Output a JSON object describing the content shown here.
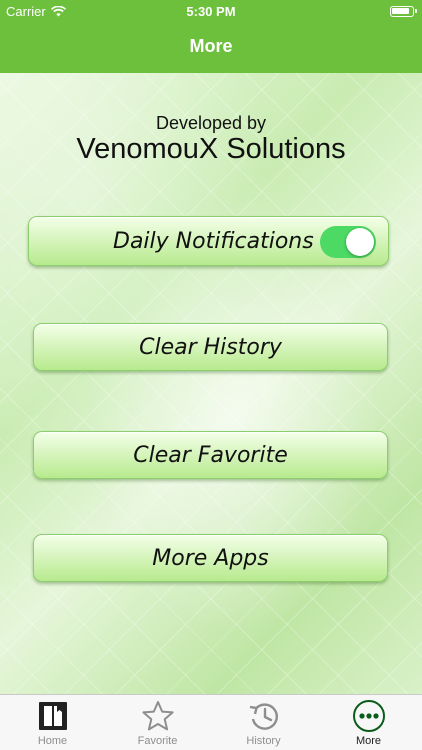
{
  "status": {
    "carrier": "Carrier",
    "time": "5:30 PM"
  },
  "nav": {
    "title": "More"
  },
  "about": {
    "label": "Developed by",
    "name": "VenomouX Solutions"
  },
  "menu": {
    "daily_notifications": {
      "label": "Daily Notifications",
      "enabled": true
    },
    "clear_history": "Clear History",
    "clear_favorite": "Clear Favorite",
    "more_apps": "More Apps"
  },
  "tabs": [
    {
      "label": "Home",
      "icon": "book-icon"
    },
    {
      "label": "Favorite",
      "icon": "star-icon"
    },
    {
      "label": "History",
      "icon": "history-icon"
    },
    {
      "label": "More",
      "icon": "more-icon",
      "active": true
    }
  ],
  "colors": {
    "nav_green": "#6cc03c",
    "toggle_on": "#4cd964",
    "active_tab": "#0a5c1a"
  }
}
